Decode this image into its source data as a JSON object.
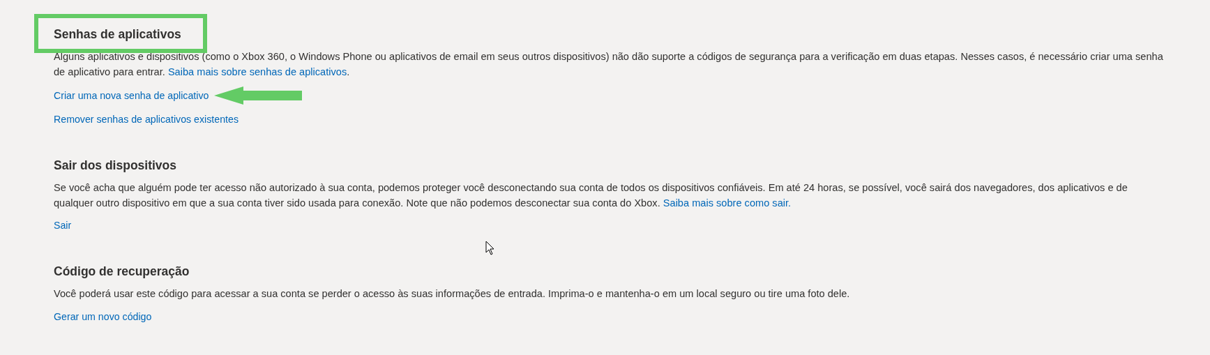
{
  "sections": [
    {
      "title": "Senhas de aplicativos",
      "highlighted": true,
      "description": "Alguns aplicativos e dispositivos (como o Xbox 360, o Windows Phone ou aplicativos de email em seus outros dispositivos) não dão suporte a códigos de segurança para a verificação em duas etapas. Nesses casos, é necessário criar uma senha de aplicativo para entrar.",
      "description_link": "Saiba mais sobre senhas de aplicativos",
      "description_end": ".",
      "actions": [
        {
          "label": "Criar uma nova senha de aplicativo",
          "arrow": true
        },
        {
          "label": "Remover senhas de aplicativos existentes",
          "arrow": false
        }
      ]
    },
    {
      "title": "Sair dos dispositivos",
      "highlighted": false,
      "description": "Se você acha que alguém pode ter acesso não autorizado à sua conta, podemos proteger você desconectando sua conta de todos os dispositivos confiáveis. Em até 24 horas, se possível, você sairá dos navegadores, dos aplicativos e de qualquer outro dispositivo em que a sua conta tiver sido usada para conexão. Note que não podemos desconectar sua conta do Xbox.",
      "description_link": "Saiba mais sobre como sair.",
      "actions": [
        {
          "label": "Sair",
          "arrow": false
        }
      ]
    },
    {
      "title": "Código de recuperação",
      "highlighted": false,
      "description": "Você poderá usar este código para acessar a sua conta se perder o acesso às suas informações de entrada. Imprima-o e mantenha-o em um local seguro ou tire uma foto dele.",
      "actions": [
        {
          "label": "Gerar um novo código",
          "arrow": false
        }
      ]
    }
  ]
}
